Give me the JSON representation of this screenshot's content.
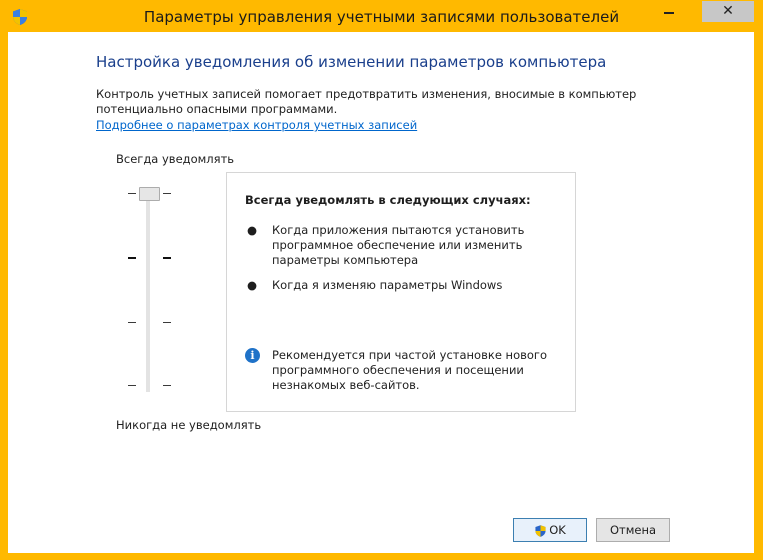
{
  "window": {
    "title": "Параметры управления учетными записями пользователей",
    "close_glyph": "✕",
    "icon": "uac-shield-icon",
    "accent": "#ffb900"
  },
  "main": {
    "heading": "Настройка уведомления об изменении параметров компьютера",
    "description": "Контроль учетных записей помогает предотвратить изменения, вносимые в компьютер потенциально опасными программами.",
    "link": "Подробнее о параметрах контроля учетных записей"
  },
  "slider": {
    "top_label": "Всегда уведомлять",
    "bottom_label": "Никогда не уведомлять",
    "levels": 4,
    "selected_level": 4
  },
  "panel": {
    "title": "Всегда уведомлять в следующих случаях:",
    "bullets": [
      "Когда приложения пытаются установить программное обеспечение или изменить параметры компьютера",
      "Когда я изменяю параметры Windows"
    ],
    "bullet_glyph": "●",
    "info_glyph": "i",
    "info_text": "Рекомендуется при частой установке нового программного обеспечения и посещении незнакомых веб-сайтов."
  },
  "buttons": {
    "ok": "OK",
    "cancel": "Отмена"
  }
}
